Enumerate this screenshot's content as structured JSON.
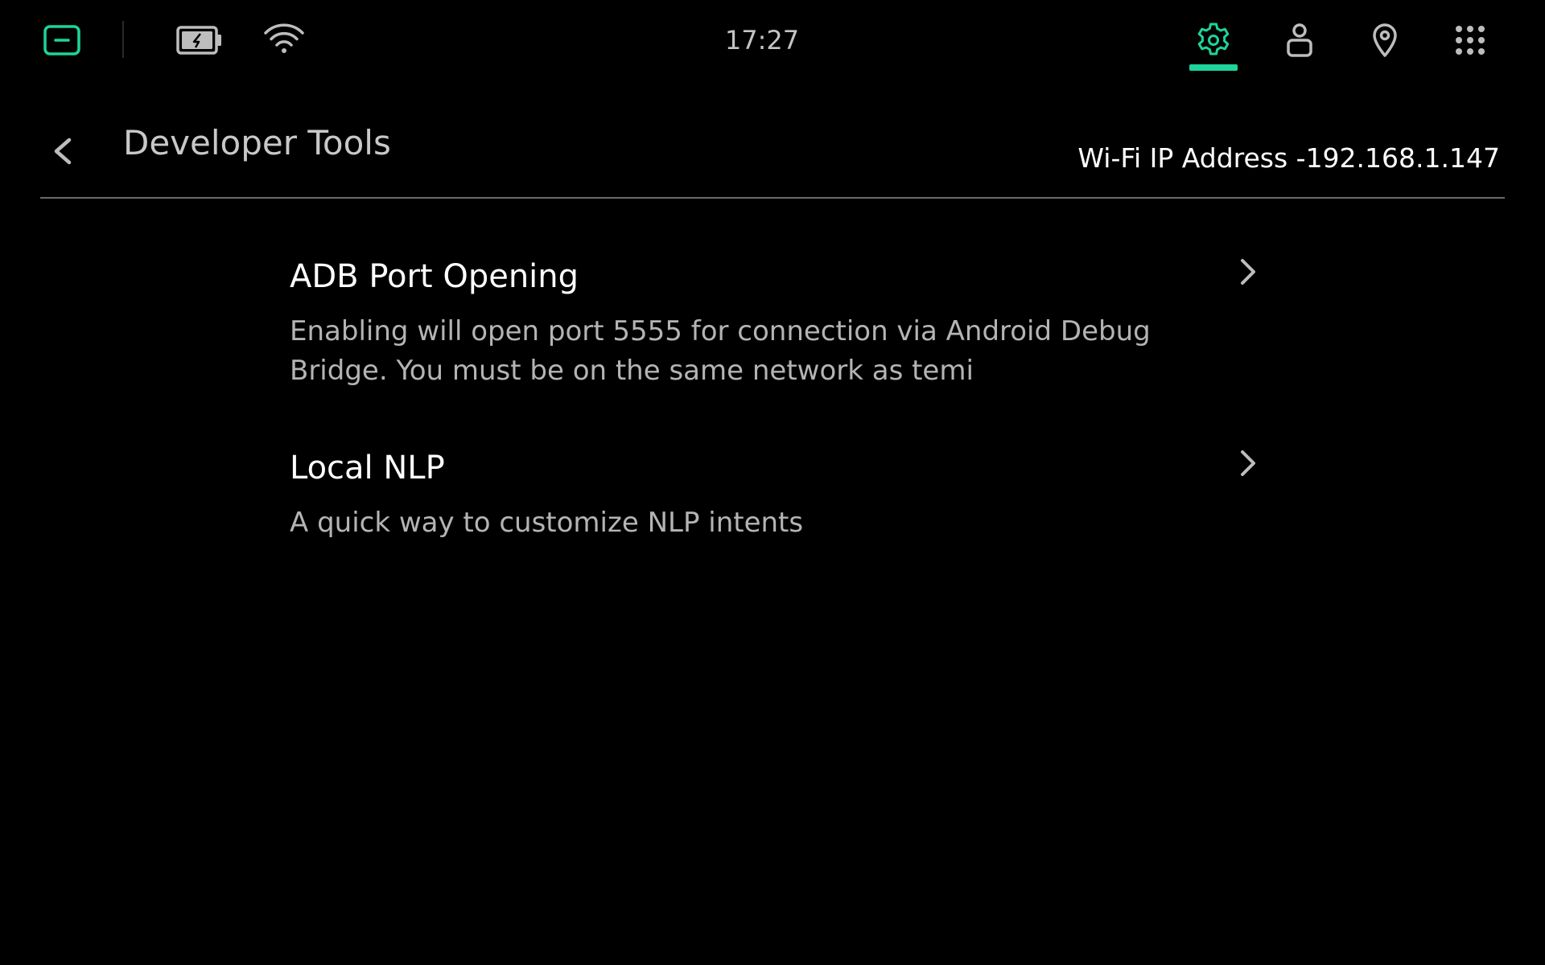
{
  "colors": {
    "accent": "#1ed49a",
    "background": "#000000",
    "icon_gray": "#bdbdbd",
    "divider": "#6a6a6a"
  },
  "status_bar": {
    "time": "17:27",
    "icons": [
      "minimize-icon",
      "battery-icon",
      "wifi-icon",
      "settings-icon",
      "user-icon",
      "location-icon",
      "apps-icon"
    ],
    "active_tab": "settings-icon"
  },
  "header": {
    "back_icon": "chevron-left-icon",
    "title": "Developer Tools",
    "ip_address": "Wi-Fi IP Address -192.168.1.147"
  },
  "items": [
    {
      "title": "ADB Port Opening",
      "description": "Enabling will open port 5555 for connection via Android Debug Bridge. You must be on the same network as temi",
      "chevron_icon": "chevron-right-icon"
    },
    {
      "title": "Local NLP",
      "description": "A quick way to customize NLP intents",
      "chevron_icon": "chevron-right-icon"
    }
  ]
}
